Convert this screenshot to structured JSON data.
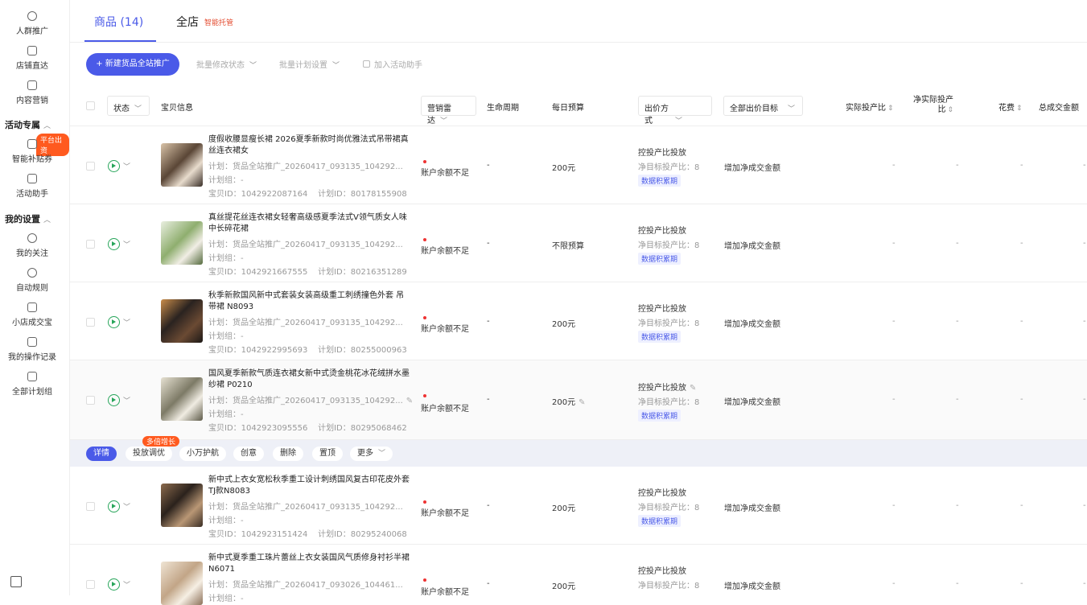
{
  "sidebar": {
    "items": [
      {
        "label": "人群推广",
        "icon": "user-icon"
      },
      {
        "label": "店铺直达",
        "icon": "store-icon"
      },
      {
        "label": "内容营销",
        "icon": "video-icon"
      },
      {
        "label": "智能补贴券",
        "icon": "coupon-icon"
      },
      {
        "label": "活动助手",
        "icon": "assistant-icon"
      },
      {
        "label": "我的关注",
        "icon": "user-icon"
      },
      {
        "label": "自动规则",
        "icon": "target-icon"
      },
      {
        "label": "小店成交宝",
        "icon": "bag-icon"
      },
      {
        "label": "我的操作记录",
        "icon": "record-icon"
      },
      {
        "label": "全部计划组",
        "icon": "folder-icon"
      }
    ],
    "section_activity": "活动专属",
    "section_settings": "我的设置",
    "coupon_badge": "平台出资"
  },
  "tabs": {
    "goods": "商品 (14)",
    "store": "全店",
    "store_tag": "智能托管"
  },
  "toolbar": {
    "new_button": "+ 新建货品全站推广",
    "batch_status": "批量修改状态",
    "batch_plan": "批量计划设置",
    "add_activity": "加入活动助手"
  },
  "table": {
    "headers": {
      "status": "状态",
      "item": "宝贝信息",
      "marketing": "营销雷达",
      "lifecycle": "生命周期",
      "budget": "每日预算",
      "bid_method": "出价方式",
      "bid_target": "全部出价目标",
      "roi": "实际投产比",
      "net_roi": "净实际投产比",
      "spend": "花费",
      "gmv": "总成交金额"
    },
    "rows": [
      {
        "title": "度假收腰显瘦长裙 2026夏季新款时尚优雅法式吊带裙真丝连衣裙女",
        "plan": "计划：货品全站推广_20260417_093135_104292...",
        "group": "计划组：-",
        "item_id": "宝贝ID：1042922087164",
        "plan_id": "计划ID：80178155908",
        "status": "账户余额不足",
        "lifecycle": "-",
        "budget": "200元",
        "bid_method": "控投产比投放",
        "net_target": "净目标投产比：8",
        "data_tag": "数据积累期",
        "goal": "增加净成交金额",
        "roi": "-",
        "net_roi": "-",
        "spend": "-",
        "gmv": "-"
      },
      {
        "title": "真丝提花丝连衣裙女轻奢高级感夏季法式V领气质女人味中长碎花裙",
        "plan": "计划：货品全站推广_20260417_093135_104292...",
        "group": "计划组：-",
        "item_id": "宝贝ID：1042921667555",
        "plan_id": "计划ID：80216351289",
        "status": "账户余额不足",
        "lifecycle": "-",
        "budget": "不限预算",
        "bid_method": "控投产比投放",
        "net_target": "净目标投产比：8",
        "data_tag": "数据积累期",
        "goal": "增加净成交金额",
        "roi": "-",
        "net_roi": "-",
        "spend": "-",
        "gmv": "-"
      },
      {
        "title": "秋季新款国风新中式套装女装高级重工刺绣撞色外套 吊带裙 N8093",
        "plan": "计划：货品全站推广_20260417_093135_104292...",
        "group": "计划组：-",
        "item_id": "宝贝ID：1042922995693",
        "plan_id": "计划ID：80255000963",
        "status": "账户余额不足",
        "lifecycle": "-",
        "budget": "200元",
        "bid_method": "控投产比投放",
        "net_target": "净目标投产比：8",
        "data_tag": "数据积累期",
        "goal": "增加净成交金额",
        "roi": "-",
        "net_roi": "-",
        "spend": "-",
        "gmv": "-"
      },
      {
        "title": "国风夏季新款气质连衣裙女新中式烫金桃花冰花绒拼水墨纱裙 P0210",
        "plan": "计划：货品全站推广_20260417_093135_104292...",
        "group": "计划组：-",
        "item_id": "宝贝ID：1042923095556",
        "plan_id": "计划ID：80295068462",
        "status": "账户余额不足",
        "lifecycle": "-",
        "budget": "200元",
        "bid_method": "控投产比投放",
        "net_target": "净目标投产比：8",
        "data_tag": "数据积累期",
        "goal": "增加净成交金额",
        "roi": "-",
        "net_roi": "-",
        "spend": "-",
        "gmv": "-"
      },
      {
        "title": "新中式上衣女宽松秋季重工设计刺绣国风复古印花皮外套TJ款N8083",
        "plan": "计划：货品全站推广_20260417_093135_104292...",
        "group": "计划组：-",
        "item_id": "宝贝ID：1042923151424",
        "plan_id": "计划ID：80295240068",
        "status": "账户余额不足",
        "lifecycle": "-",
        "budget": "200元",
        "bid_method": "控投产比投放",
        "net_target": "净目标投产比：8",
        "data_tag": "数据积累期",
        "goal": "增加净成交金额",
        "roi": "-",
        "net_roi": "-",
        "spend": "-",
        "gmv": "-"
      },
      {
        "title": "新中式夏季重工珠片蕾丝上衣女装国风气质修身衬衫半裙 N6071",
        "plan": "计划：货品全站推广_20260417_093026_104461...",
        "group": "计划组：-",
        "item_id": "",
        "plan_id": "",
        "status": "账户余额不足",
        "lifecycle": "-",
        "budget": "200元",
        "bid_method": "控投产比投放",
        "net_target": "净目标投产比：8",
        "data_tag": "",
        "goal": "增加净成交金额",
        "roi": "-",
        "net_roi": "-",
        "spend": "-",
        "gmv": "-"
      }
    ]
  },
  "actions": {
    "details": "详情",
    "optimize": "投放调优",
    "optimize_badge": "多倍增长",
    "assistant": "小万护航",
    "creative": "创意",
    "delete": "删除",
    "pin": "置顶",
    "more": "更多"
  }
}
